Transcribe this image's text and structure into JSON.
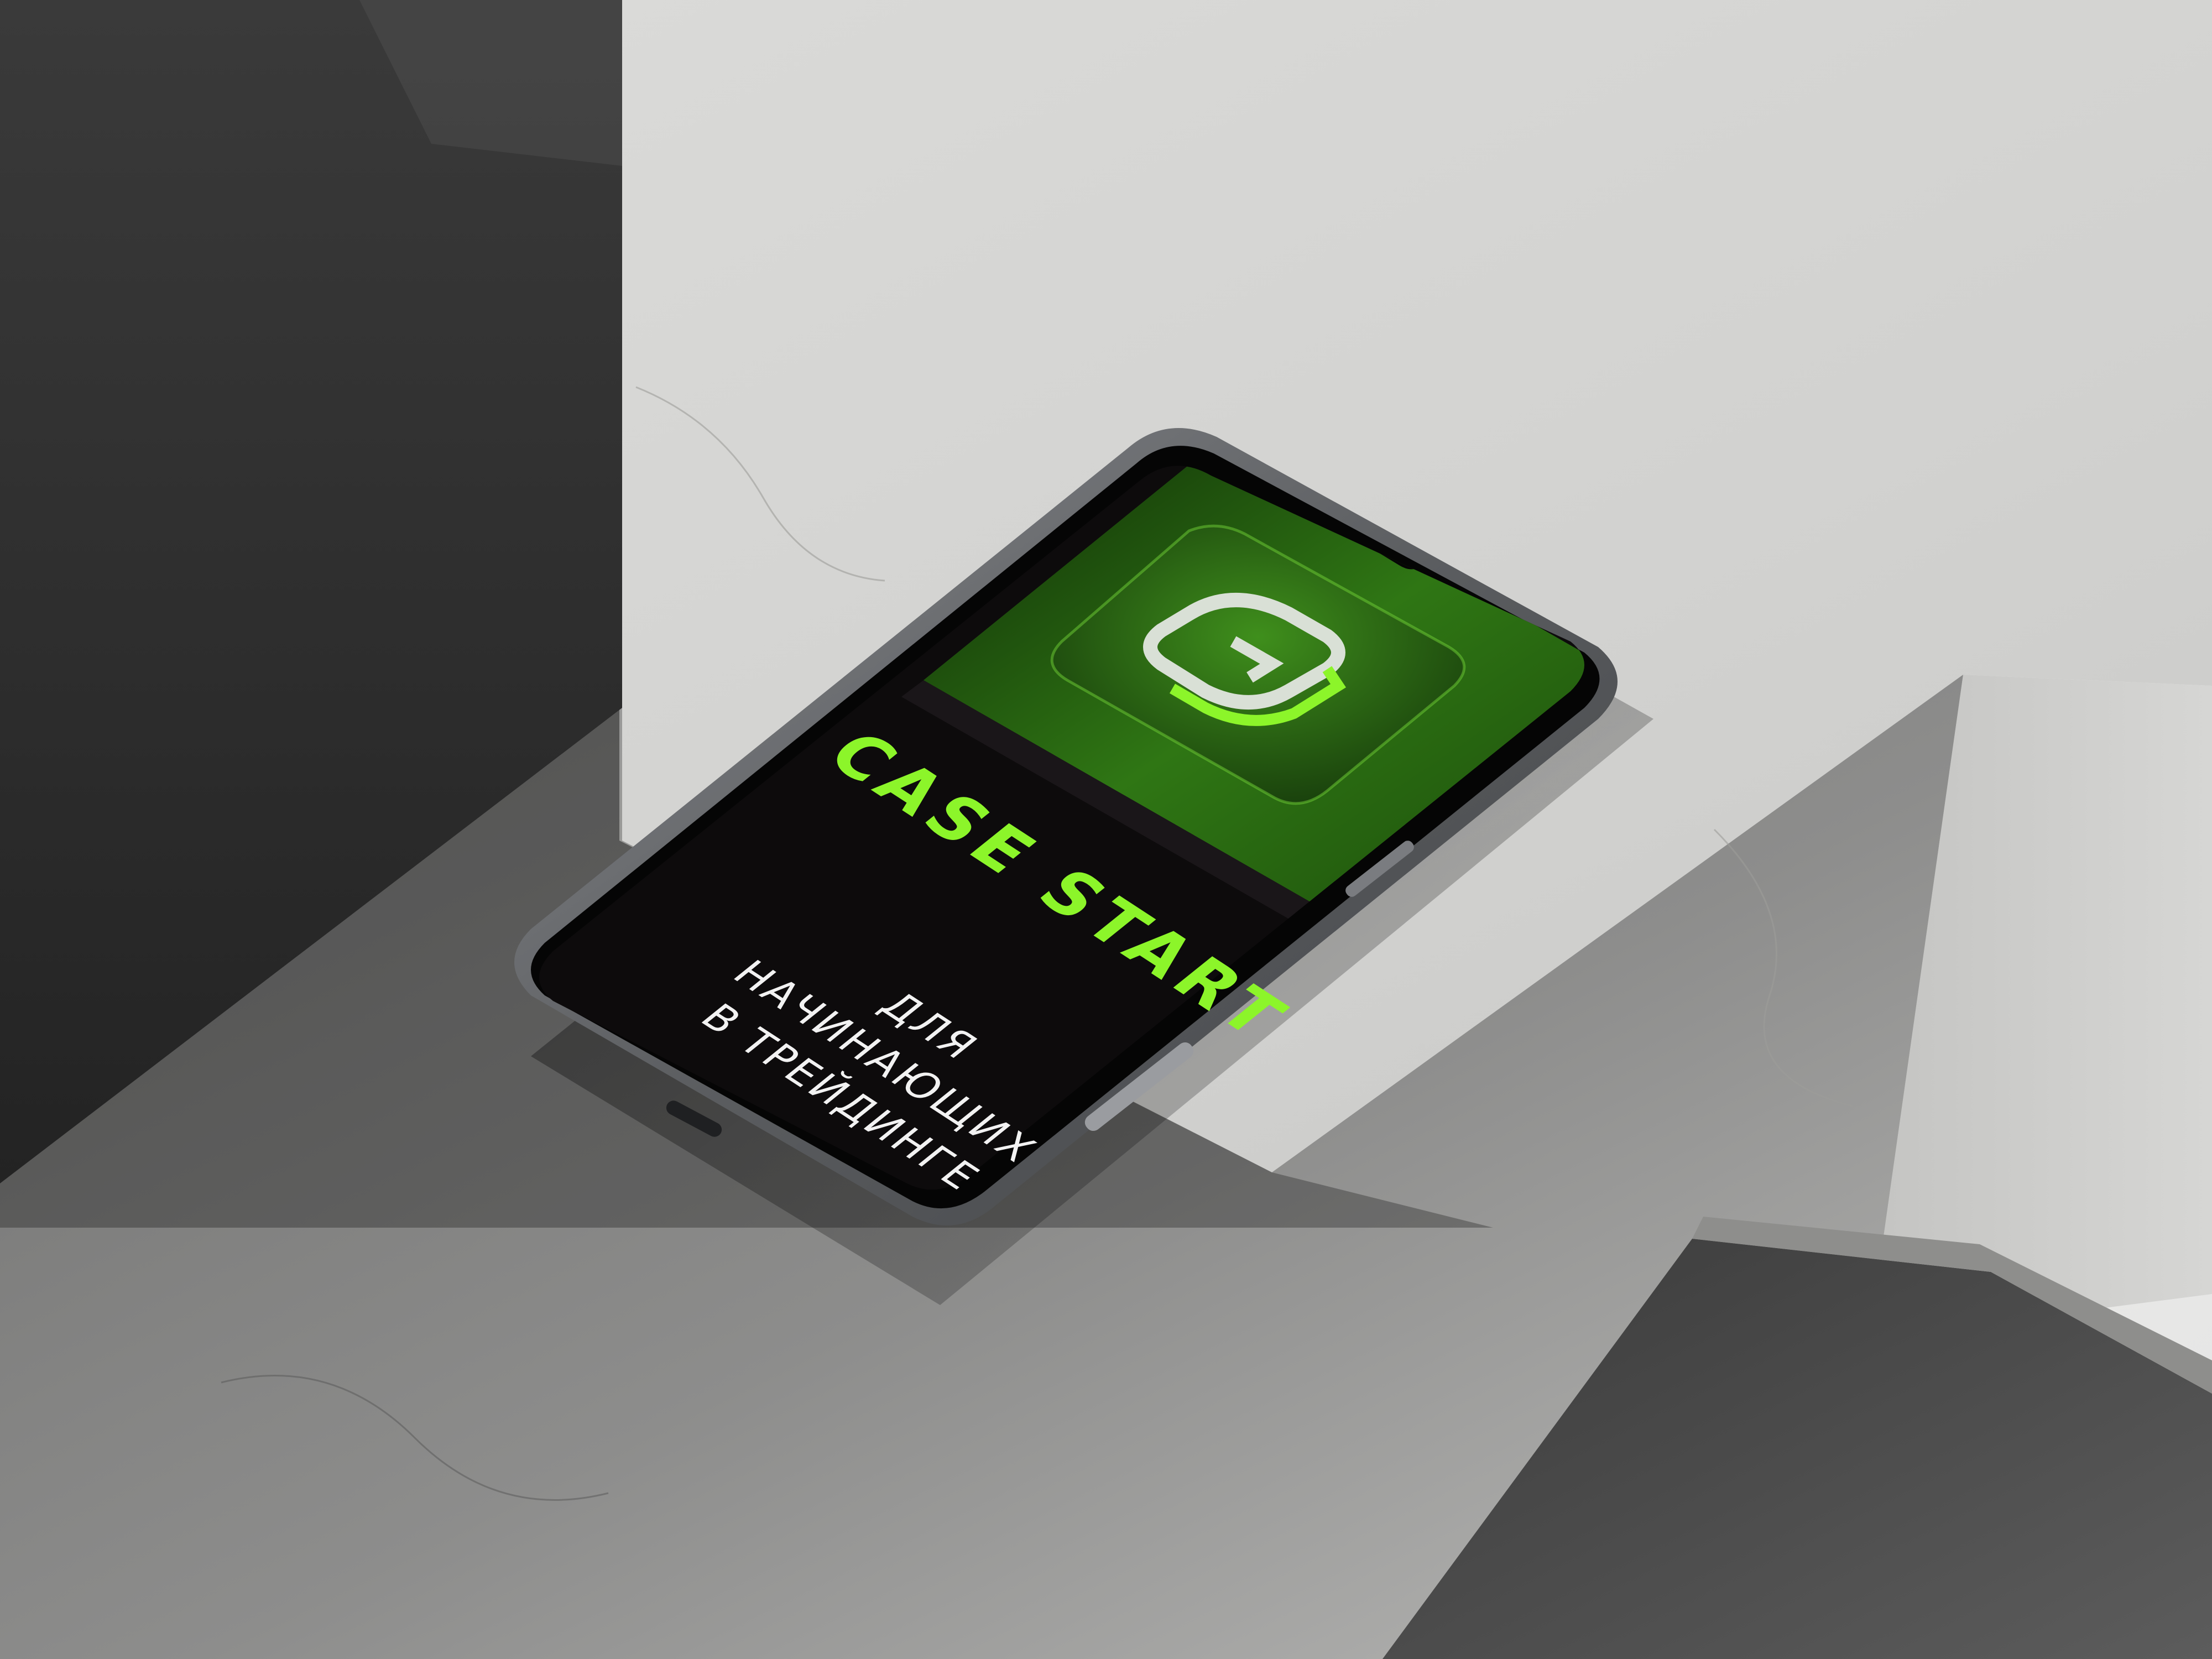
{
  "screen": {
    "title": "CASE START",
    "tagline": "для\nначинающих\nв трейдинге"
  },
  "colors": {
    "accent": "#8cf52a",
    "screen_bg": "#0d0b0c",
    "screen_green": "#2c6a12",
    "tagline": "#f2f2f2",
    "concrete_light": "#d6d6d4",
    "concrete_dark": "#2a2a2a",
    "phone_frame": "#5b5d60"
  },
  "icons": {
    "app_icon": "g-logo-icon"
  }
}
